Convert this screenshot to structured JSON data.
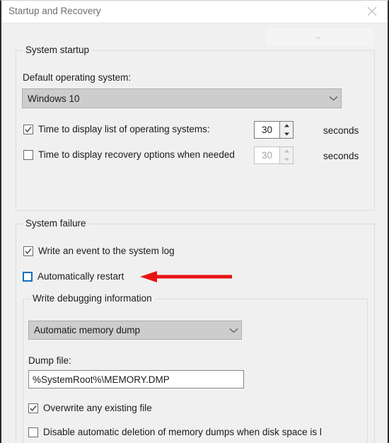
{
  "window": {
    "title": "Startup and Recovery",
    "close_icon": "close-icon"
  },
  "system_startup": {
    "legend": "System startup",
    "default_os_label": "Default operating system:",
    "default_os_value": "Windows 10",
    "timeout_os": {
      "label": "Time to display list of operating systems:",
      "checked": true,
      "value": "30",
      "units": "seconds"
    },
    "timeout_recovery": {
      "label": "Time to display recovery options when needed",
      "checked": false,
      "value": "30",
      "units": "seconds",
      "disabled": true
    }
  },
  "system_failure": {
    "legend": "System failure",
    "write_event": {
      "label": "Write an event to the system log",
      "checked": true
    },
    "auto_restart": {
      "label": "Automatically restart",
      "checked": false,
      "focused": true
    },
    "debugging": {
      "legend": "Write debugging information",
      "dump_type_value": "Automatic memory dump",
      "dump_file_label": "Dump file:",
      "dump_file_value": "%SystemRoot%\\MEMORY.DMP",
      "overwrite": {
        "label": "Overwrite any existing file",
        "checked": true
      },
      "disable_deletion": {
        "label": "Disable automatic deletion of memory dumps when disk space is l",
        "checked": false
      }
    }
  },
  "annotation": {
    "arrow_color": "#e81313",
    "points_at": "Automatically restart"
  }
}
